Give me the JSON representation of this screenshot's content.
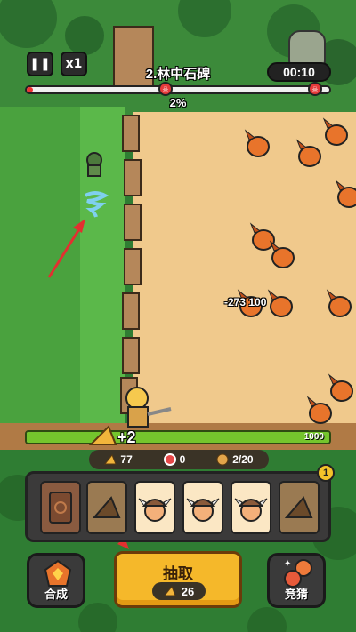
{
  "hud": {
    "pause_icon": "pause-icon",
    "speed_label": "x1",
    "level_title": "2.林中石碑",
    "timer": "00:10",
    "wave_progress_text": "2%",
    "wave_progress": 0.02
  },
  "base": {
    "hp_value": "1000",
    "hp_fraction": 1.0,
    "plus_text": "+2"
  },
  "resources": {
    "cheese": "77",
    "crystal": "0",
    "population": "2/20"
  },
  "battle": {
    "damage_text": "-273 100"
  },
  "tray": {
    "badge": "1",
    "cards": [
      {
        "type": "trap",
        "icon": "rune-card-icon"
      },
      {
        "type": "cheese",
        "icon": "cheese-card-icon"
      },
      {
        "type": "viking",
        "icon": "viking-card-icon"
      },
      {
        "type": "viking",
        "icon": "viking-card-icon"
      },
      {
        "type": "viking",
        "icon": "viking-card-icon"
      },
      {
        "type": "cheese",
        "icon": "cheese-card-icon"
      }
    ]
  },
  "buttons": {
    "merge_label": "合成",
    "draw_label": "抽取",
    "draw_cost": "26",
    "guess_label": "竞猜"
  },
  "colors": {
    "grass": "#2f7d33",
    "dirt": "#f0c98c",
    "accent_gold": "#f5b82a",
    "enemy_orange": "#e8742b"
  }
}
